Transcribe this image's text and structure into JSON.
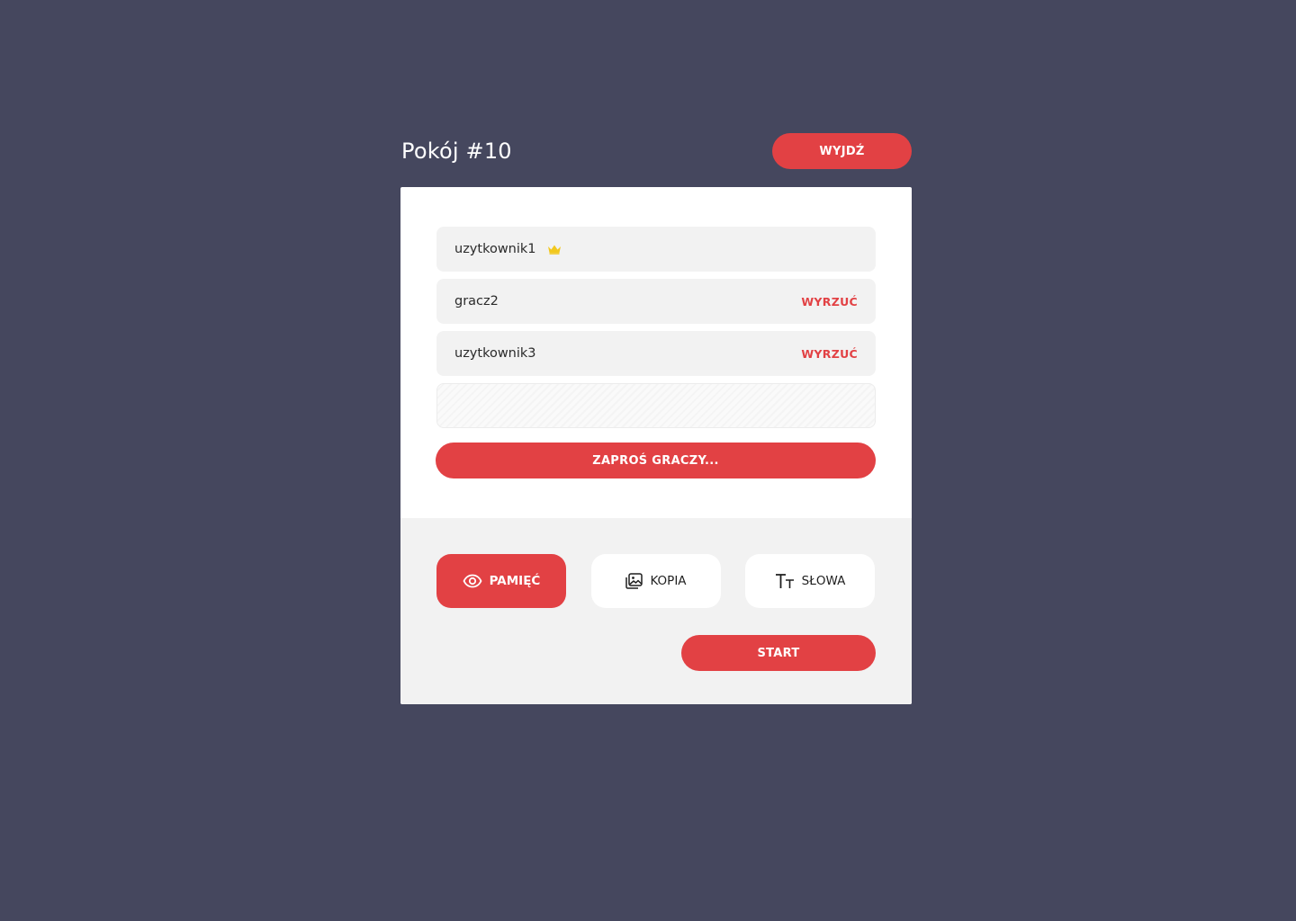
{
  "room": {
    "title": "Pokój #10",
    "leave_label": "WYJDŹ"
  },
  "players": [
    {
      "name": "uzytkownik1",
      "icon": "crown-icon",
      "kick_label": ""
    },
    {
      "name": "gracz2",
      "icon": "",
      "kick_label": "WYRZUĆ"
    },
    {
      "name": "uzytkownik3",
      "icon": "",
      "kick_label": "WYRZUĆ"
    }
  ],
  "empty_slots": 1,
  "invite_label": "ZAPROŚ GRACZY...",
  "modes": [
    {
      "label": "PAMIĘĆ",
      "icon": "eye-icon",
      "selected": true
    },
    {
      "label": "KOPIA",
      "icon": "image-icon",
      "selected": false
    },
    {
      "label": "SŁOWA",
      "icon": "text-size-icon",
      "selected": false
    }
  ],
  "start_label": "START",
  "colors": {
    "background": "#45475e",
    "accent": "#e24144",
    "crown": "#f2c81e",
    "row_bg": "#f2f2f2"
  }
}
